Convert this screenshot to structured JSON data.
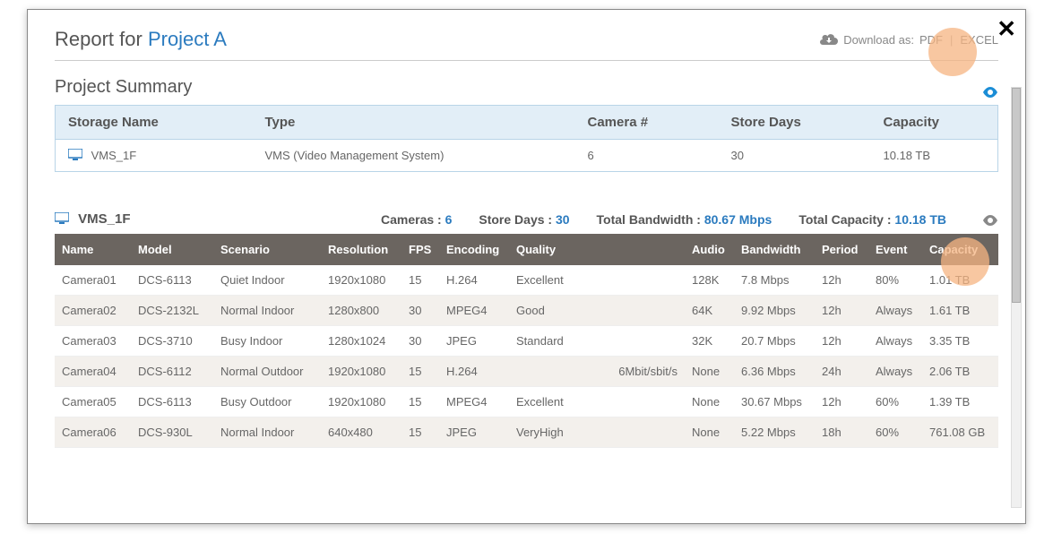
{
  "header": {
    "title_prefix": "Report for ",
    "project_name": "Project A",
    "download_label": "Download as:",
    "pdf": "PDF",
    "excel": "EXCEL"
  },
  "summary": {
    "title": "Project Summary",
    "cols": {
      "storage": "Storage Name",
      "type": "Type",
      "camera": "Camera #",
      "days": "Store Days",
      "capacity": "Capacity"
    },
    "row": {
      "storage": "VMS_1F",
      "type": "VMS (Video Management System)",
      "camera": "6",
      "days": "30",
      "capacity": "10.18 TB"
    }
  },
  "storage": {
    "name": "VMS_1F",
    "stats": {
      "cameras_label": "Cameras :",
      "cameras": "6",
      "days_label": "Store Days :",
      "days": "30",
      "bw_label": "Total Bandwidth :",
      "bw": "80.67 Mbps",
      "cap_label": "Total Capacity :",
      "cap": "10.18 TB"
    },
    "cols": {
      "name": "Name",
      "model": "Model",
      "scenario": "Scenario",
      "resolution": "Resolution",
      "fps": "FPS",
      "encoding": "Encoding",
      "quality": "Quality",
      "audio": "Audio",
      "bandwidth": "Bandwidth",
      "period": "Period",
      "event": "Event",
      "capacity": "Capacity"
    },
    "rows": [
      {
        "name": "Camera01",
        "model": "DCS-6113",
        "scenario": "Quiet Indoor",
        "resolution": "1920x1080",
        "fps": "15",
        "encoding": "H.264",
        "quality": "Excellent",
        "audio": "128K",
        "bandwidth": "7.8 Mbps",
        "period": "12h",
        "event": "80%",
        "capacity": "1.01 TB"
      },
      {
        "name": "Camera02",
        "model": "DCS-2132L",
        "scenario": "Normal Indoor",
        "resolution": "1280x800",
        "fps": "30",
        "encoding": "MPEG4",
        "quality": "Good",
        "audio": "64K",
        "bandwidth": "9.92 Mbps",
        "period": "12h",
        "event": "Always",
        "capacity": "1.61 TB"
      },
      {
        "name": "Camera03",
        "model": "DCS-3710",
        "scenario": "Busy Indoor",
        "resolution": "1280x1024",
        "fps": "30",
        "encoding": "JPEG",
        "quality": "Standard",
        "audio": "32K",
        "bandwidth": "20.7 Mbps",
        "period": "12h",
        "event": "Always",
        "capacity": "3.35 TB"
      },
      {
        "name": "Camera04",
        "model": "DCS-6112",
        "scenario": "Normal Outdoor",
        "resolution": "1920x1080",
        "fps": "15",
        "encoding": "H.264",
        "quality": "6Mbit/sbit/s",
        "audio": "None",
        "bandwidth": "6.36 Mbps",
        "period": "24h",
        "event": "Always",
        "capacity": "2.06 TB"
      },
      {
        "name": "Camera05",
        "model": "DCS-6113",
        "scenario": "Busy Outdoor",
        "resolution": "1920x1080",
        "fps": "15",
        "encoding": "MPEG4",
        "quality": "Excellent",
        "audio": "None",
        "bandwidth": "30.67 Mbps",
        "period": "12h",
        "event": "60%",
        "capacity": "1.39 TB"
      },
      {
        "name": "Camera06",
        "model": "DCS-930L",
        "scenario": "Normal Indoor",
        "resolution": "640x480",
        "fps": "15",
        "encoding": "JPEG",
        "quality": "VeryHigh",
        "audio": "None",
        "bandwidth": "5.22 Mbps",
        "period": "18h",
        "event": "60%",
        "capacity": "761.08 GB"
      }
    ]
  }
}
